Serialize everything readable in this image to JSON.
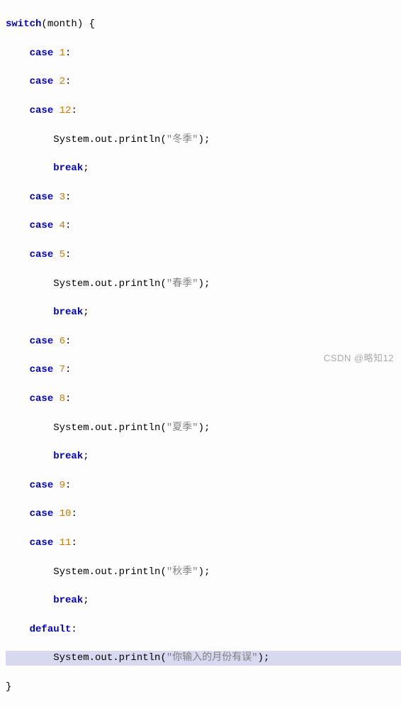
{
  "code": {
    "switch_kw": "switch",
    "switch_var": "month",
    "case_kw": "case",
    "break_kw": "break",
    "default_kw": "default",
    "print_call": "System.out.println",
    "nums": {
      "n1": "1",
      "n2": "2",
      "n3": "3",
      "n4": "4",
      "n5": "5",
      "n6": "6",
      "n7": "7",
      "n8": "8",
      "n9": "9",
      "n10": "10",
      "n11": "11",
      "n12": "12"
    },
    "strings": {
      "winter": "\"冬季\"",
      "spring": "\"春季\"",
      "summer": "\"夏季\"",
      "autumn": "\"秋季\"",
      "error": "\"你输入的月份有误\""
    },
    "punct": {
      "lparen": "(",
      "rparen": ")",
      "lbrace": "{",
      "rbrace": "}",
      "colon": ":",
      "semi": ";"
    }
  },
  "watermark": "CSDN @略知12"
}
